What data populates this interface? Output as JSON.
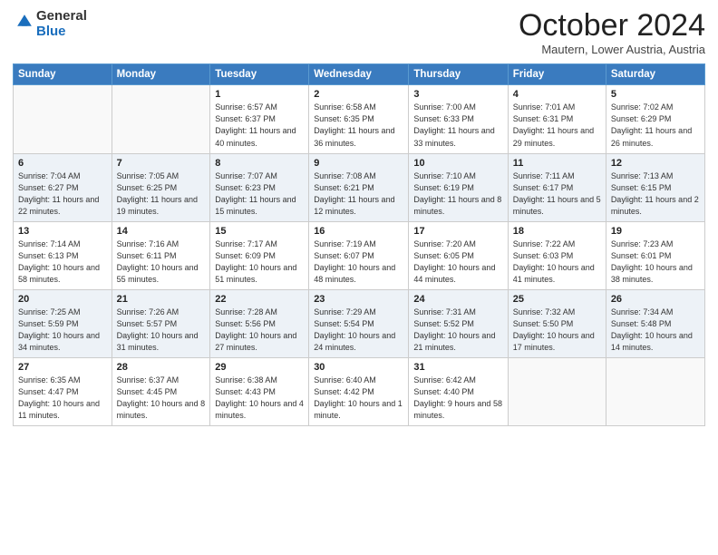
{
  "header": {
    "logo_general": "General",
    "logo_blue": "Blue",
    "month_title": "October 2024",
    "location": "Mautern, Lower Austria, Austria"
  },
  "weekdays": [
    "Sunday",
    "Monday",
    "Tuesday",
    "Wednesday",
    "Thursday",
    "Friday",
    "Saturday"
  ],
  "weeks": [
    [
      {
        "day": "",
        "sunrise": "",
        "sunset": "",
        "daylight": ""
      },
      {
        "day": "",
        "sunrise": "",
        "sunset": "",
        "daylight": ""
      },
      {
        "day": "1",
        "sunrise": "Sunrise: 6:57 AM",
        "sunset": "Sunset: 6:37 PM",
        "daylight": "Daylight: 11 hours and 40 minutes."
      },
      {
        "day": "2",
        "sunrise": "Sunrise: 6:58 AM",
        "sunset": "Sunset: 6:35 PM",
        "daylight": "Daylight: 11 hours and 36 minutes."
      },
      {
        "day": "3",
        "sunrise": "Sunrise: 7:00 AM",
        "sunset": "Sunset: 6:33 PM",
        "daylight": "Daylight: 11 hours and 33 minutes."
      },
      {
        "day": "4",
        "sunrise": "Sunrise: 7:01 AM",
        "sunset": "Sunset: 6:31 PM",
        "daylight": "Daylight: 11 hours and 29 minutes."
      },
      {
        "day": "5",
        "sunrise": "Sunrise: 7:02 AM",
        "sunset": "Sunset: 6:29 PM",
        "daylight": "Daylight: 11 hours and 26 minutes."
      }
    ],
    [
      {
        "day": "6",
        "sunrise": "Sunrise: 7:04 AM",
        "sunset": "Sunset: 6:27 PM",
        "daylight": "Daylight: 11 hours and 22 minutes."
      },
      {
        "day": "7",
        "sunrise": "Sunrise: 7:05 AM",
        "sunset": "Sunset: 6:25 PM",
        "daylight": "Daylight: 11 hours and 19 minutes."
      },
      {
        "day": "8",
        "sunrise": "Sunrise: 7:07 AM",
        "sunset": "Sunset: 6:23 PM",
        "daylight": "Daylight: 11 hours and 15 minutes."
      },
      {
        "day": "9",
        "sunrise": "Sunrise: 7:08 AM",
        "sunset": "Sunset: 6:21 PM",
        "daylight": "Daylight: 11 hours and 12 minutes."
      },
      {
        "day": "10",
        "sunrise": "Sunrise: 7:10 AM",
        "sunset": "Sunset: 6:19 PM",
        "daylight": "Daylight: 11 hours and 8 minutes."
      },
      {
        "day": "11",
        "sunrise": "Sunrise: 7:11 AM",
        "sunset": "Sunset: 6:17 PM",
        "daylight": "Daylight: 11 hours and 5 minutes."
      },
      {
        "day": "12",
        "sunrise": "Sunrise: 7:13 AM",
        "sunset": "Sunset: 6:15 PM",
        "daylight": "Daylight: 11 hours and 2 minutes."
      }
    ],
    [
      {
        "day": "13",
        "sunrise": "Sunrise: 7:14 AM",
        "sunset": "Sunset: 6:13 PM",
        "daylight": "Daylight: 10 hours and 58 minutes."
      },
      {
        "day": "14",
        "sunrise": "Sunrise: 7:16 AM",
        "sunset": "Sunset: 6:11 PM",
        "daylight": "Daylight: 10 hours and 55 minutes."
      },
      {
        "day": "15",
        "sunrise": "Sunrise: 7:17 AM",
        "sunset": "Sunset: 6:09 PM",
        "daylight": "Daylight: 10 hours and 51 minutes."
      },
      {
        "day": "16",
        "sunrise": "Sunrise: 7:19 AM",
        "sunset": "Sunset: 6:07 PM",
        "daylight": "Daylight: 10 hours and 48 minutes."
      },
      {
        "day": "17",
        "sunrise": "Sunrise: 7:20 AM",
        "sunset": "Sunset: 6:05 PM",
        "daylight": "Daylight: 10 hours and 44 minutes."
      },
      {
        "day": "18",
        "sunrise": "Sunrise: 7:22 AM",
        "sunset": "Sunset: 6:03 PM",
        "daylight": "Daylight: 10 hours and 41 minutes."
      },
      {
        "day": "19",
        "sunrise": "Sunrise: 7:23 AM",
        "sunset": "Sunset: 6:01 PM",
        "daylight": "Daylight: 10 hours and 38 minutes."
      }
    ],
    [
      {
        "day": "20",
        "sunrise": "Sunrise: 7:25 AM",
        "sunset": "Sunset: 5:59 PM",
        "daylight": "Daylight: 10 hours and 34 minutes."
      },
      {
        "day": "21",
        "sunrise": "Sunrise: 7:26 AM",
        "sunset": "Sunset: 5:57 PM",
        "daylight": "Daylight: 10 hours and 31 minutes."
      },
      {
        "day": "22",
        "sunrise": "Sunrise: 7:28 AM",
        "sunset": "Sunset: 5:56 PM",
        "daylight": "Daylight: 10 hours and 27 minutes."
      },
      {
        "day": "23",
        "sunrise": "Sunrise: 7:29 AM",
        "sunset": "Sunset: 5:54 PM",
        "daylight": "Daylight: 10 hours and 24 minutes."
      },
      {
        "day": "24",
        "sunrise": "Sunrise: 7:31 AM",
        "sunset": "Sunset: 5:52 PM",
        "daylight": "Daylight: 10 hours and 21 minutes."
      },
      {
        "day": "25",
        "sunrise": "Sunrise: 7:32 AM",
        "sunset": "Sunset: 5:50 PM",
        "daylight": "Daylight: 10 hours and 17 minutes."
      },
      {
        "day": "26",
        "sunrise": "Sunrise: 7:34 AM",
        "sunset": "Sunset: 5:48 PM",
        "daylight": "Daylight: 10 hours and 14 minutes."
      }
    ],
    [
      {
        "day": "27",
        "sunrise": "Sunrise: 6:35 AM",
        "sunset": "Sunset: 4:47 PM",
        "daylight": "Daylight: 10 hours and 11 minutes."
      },
      {
        "day": "28",
        "sunrise": "Sunrise: 6:37 AM",
        "sunset": "Sunset: 4:45 PM",
        "daylight": "Daylight: 10 hours and 8 minutes."
      },
      {
        "day": "29",
        "sunrise": "Sunrise: 6:38 AM",
        "sunset": "Sunset: 4:43 PM",
        "daylight": "Daylight: 10 hours and 4 minutes."
      },
      {
        "day": "30",
        "sunrise": "Sunrise: 6:40 AM",
        "sunset": "Sunset: 4:42 PM",
        "daylight": "Daylight: 10 hours and 1 minute."
      },
      {
        "day": "31",
        "sunrise": "Sunrise: 6:42 AM",
        "sunset": "Sunset: 4:40 PM",
        "daylight": "Daylight: 9 hours and 58 minutes."
      },
      {
        "day": "",
        "sunrise": "",
        "sunset": "",
        "daylight": ""
      },
      {
        "day": "",
        "sunrise": "",
        "sunset": "",
        "daylight": ""
      }
    ]
  ]
}
